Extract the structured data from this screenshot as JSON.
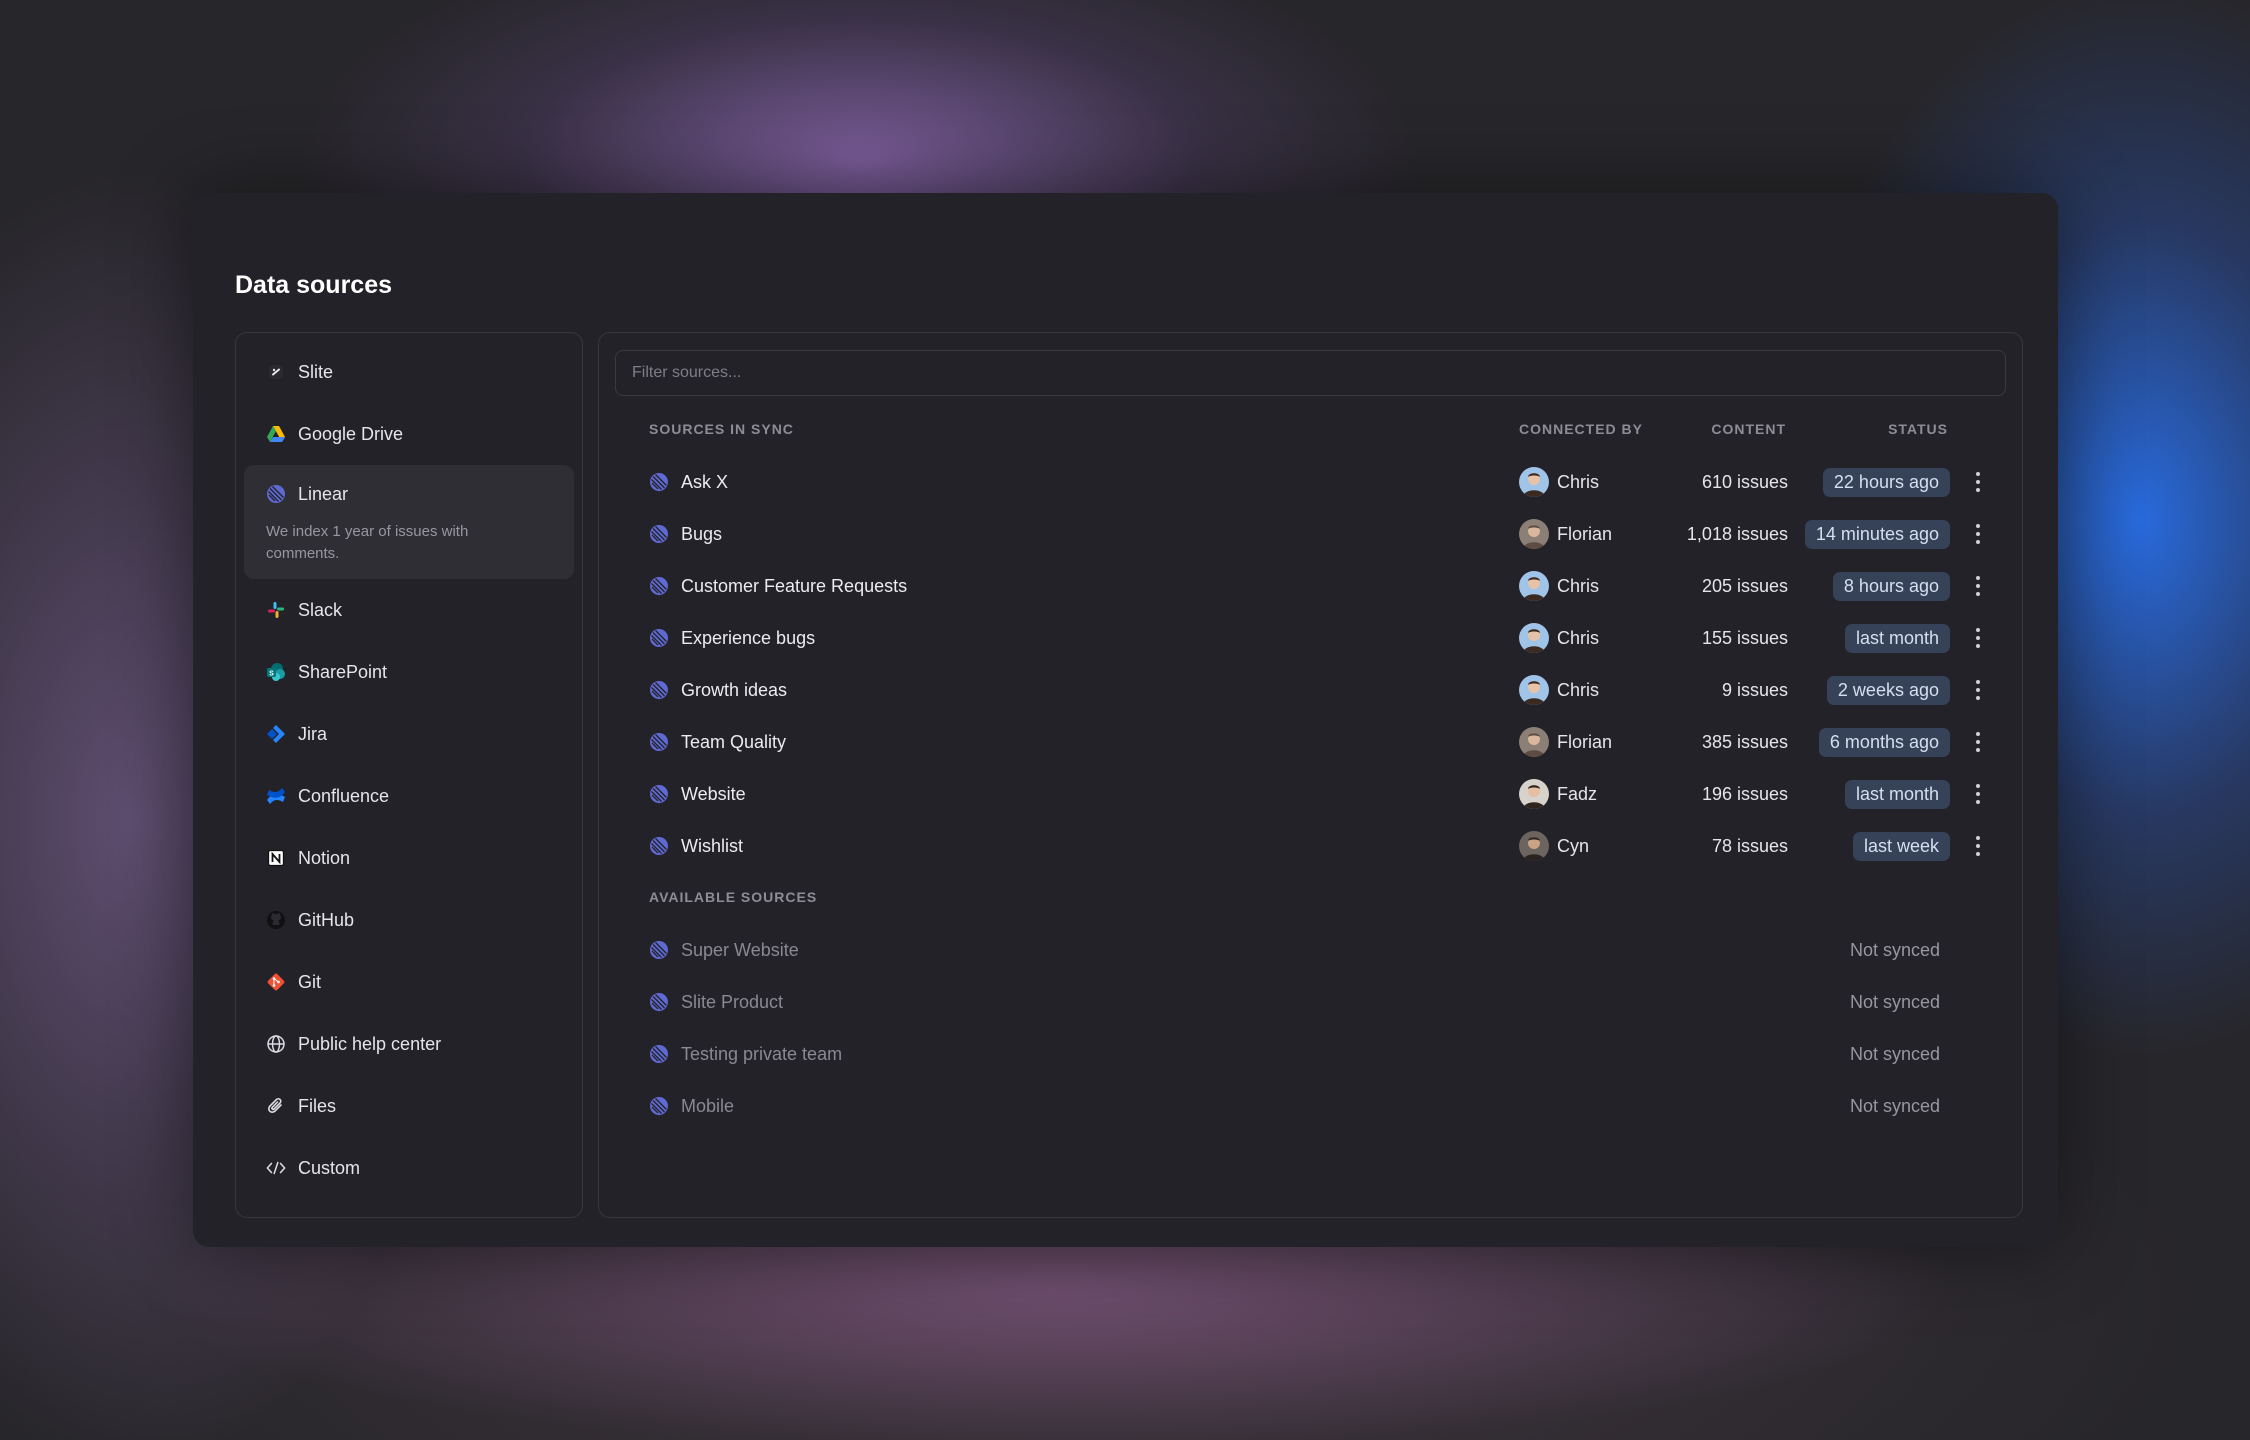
{
  "title": "Data sources",
  "sidebar": {
    "items": [
      {
        "label": "Slite",
        "icon": "slite-icon"
      },
      {
        "label": "Google Drive",
        "icon": "google-drive-icon"
      },
      {
        "label": "Linear",
        "icon": "linear-icon",
        "active": true,
        "description": "We index 1 year of issues with comments."
      },
      {
        "label": "Slack",
        "icon": "slack-icon"
      },
      {
        "label": "SharePoint",
        "icon": "sharepoint-icon"
      },
      {
        "label": "Jira",
        "icon": "jira-icon"
      },
      {
        "label": "Confluence",
        "icon": "confluence-icon"
      },
      {
        "label": "Notion",
        "icon": "notion-icon"
      },
      {
        "label": "GitHub",
        "icon": "github-icon"
      },
      {
        "label": "Git",
        "icon": "git-icon"
      },
      {
        "label": "Public help center",
        "icon": "globe-icon"
      },
      {
        "label": "Files",
        "icon": "paperclip-icon"
      },
      {
        "label": "Custom",
        "icon": "code-icon"
      }
    ]
  },
  "filter": {
    "placeholder": "Filter sources..."
  },
  "table": {
    "headers": {
      "sources_in_sync": "SOURCES IN SYNC",
      "connected_by": "CONNECTED BY",
      "content": "CONTENT",
      "status": "STATUS",
      "available_sources": "AVAILABLE SOURCES"
    },
    "synced": [
      {
        "name": "Ask X",
        "user": "Chris",
        "content": "610 issues",
        "status": "22 hours ago"
      },
      {
        "name": "Bugs",
        "user": "Florian",
        "content": "1,018 issues",
        "status": "14 minutes ago"
      },
      {
        "name": "Customer Feature Requests",
        "user": "Chris",
        "content": "205 issues",
        "status": "8 hours ago"
      },
      {
        "name": "Experience bugs",
        "user": "Chris",
        "content": "155 issues",
        "status": "last month"
      },
      {
        "name": "Growth ideas",
        "user": "Chris",
        "content": "9 issues",
        "status": "2 weeks ago"
      },
      {
        "name": "Team Quality",
        "user": "Florian",
        "content": "385 issues",
        "status": "6 months ago"
      },
      {
        "name": "Website",
        "user": "Fadz",
        "content": "196 issues",
        "status": "last month"
      },
      {
        "name": "Wishlist",
        "user": "Cyn",
        "content": "78 issues",
        "status": "last week"
      }
    ],
    "available": [
      {
        "name": "Super Website",
        "status": "Not synced"
      },
      {
        "name": "Slite Product",
        "status": "Not synced"
      },
      {
        "name": "Testing private team",
        "status": "Not synced"
      },
      {
        "name": "Mobile",
        "status": "Not synced"
      }
    ]
  },
  "colors": {
    "accent_badge": "#364258",
    "linear": "#5e6ad2",
    "panel": "#232228"
  }
}
